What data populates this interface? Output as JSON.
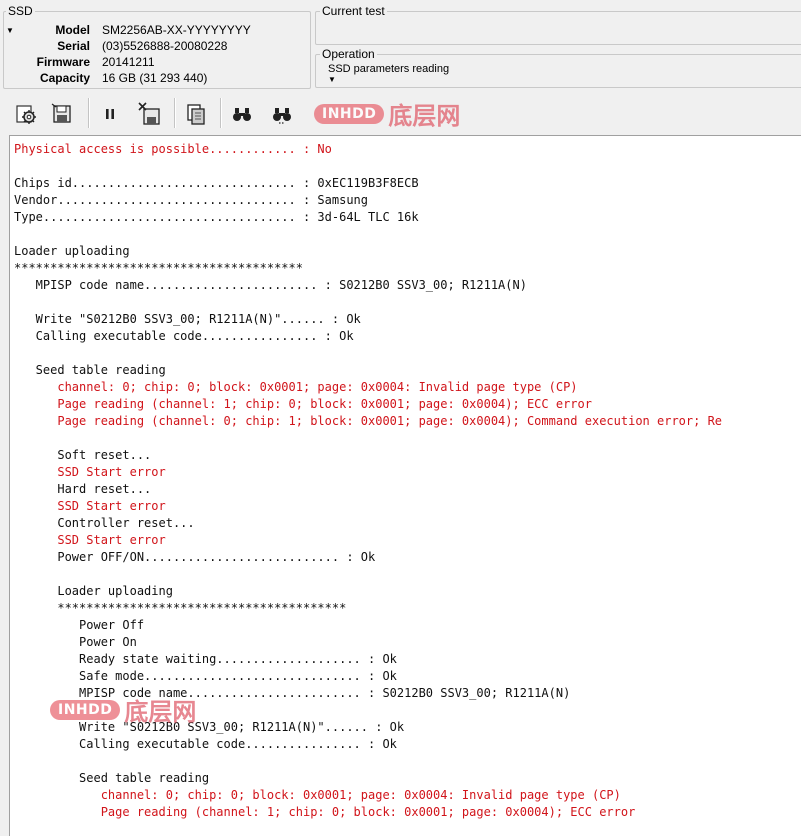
{
  "ssd_panel": {
    "title": "SSD",
    "fields": [
      {
        "label": "Model",
        "value": "SM2256AB-XX-YYYYYYYY"
      },
      {
        "label": "Serial",
        "value": "(03)5526888-20080228"
      },
      {
        "label": "Firmware",
        "value": "20141211"
      },
      {
        "label": "Capacity",
        "value": "16 GB (31 293 440)"
      }
    ]
  },
  "current_test": {
    "title": "Current test",
    "value": ""
  },
  "operation": {
    "title": "Operation",
    "value": "SSD parameters reading"
  },
  "toolbar": {
    "buttons": [
      {
        "icon": "gear-settings-icon"
      },
      {
        "icon": "save-drive-icon"
      },
      {
        "icon": "pause-icon"
      },
      {
        "icon": "cancel-save-icon"
      },
      {
        "icon": "copy-icon"
      },
      {
        "icon": "binoculars-icon"
      },
      {
        "icon": "binoculars-next-icon"
      }
    ]
  },
  "watermark": {
    "logo_text": "INHDD",
    "site_text": "底层网"
  },
  "log": [
    {
      "text": "Physical access is possible............ : No",
      "level": "error"
    },
    {
      "text": "",
      "level": "info"
    },
    {
      "text": "Chips id............................... : 0xEC119B3F8ECB",
      "level": "info"
    },
    {
      "text": "Vendor................................. : Samsung",
      "level": "info"
    },
    {
      "text": "Type................................... : 3d-64L TLC 16k",
      "level": "info"
    },
    {
      "text": "",
      "level": "info"
    },
    {
      "text": "Loader uploading",
      "level": "info"
    },
    {
      "text": "****************************************",
      "level": "info"
    },
    {
      "text": "   MPISP code name........................ : S0212B0 SSV3_00; R1211A(N)",
      "level": "info"
    },
    {
      "text": "",
      "level": "info"
    },
    {
      "text": "   Write \"S0212B0 SSV3_00; R1211A(N)\"...... : Ok",
      "level": "info"
    },
    {
      "text": "   Calling executable code................ : Ok",
      "level": "info"
    },
    {
      "text": "",
      "level": "info"
    },
    {
      "text": "   Seed table reading",
      "level": "info"
    },
    {
      "text": "      channel: 0; chip: 0; block: 0x0001; page: 0x0004: Invalid page type (CP)",
      "level": "error"
    },
    {
      "text": "      Page reading (channel: 1; chip: 0; block: 0x0001; page: 0x0004); ECC error",
      "level": "error"
    },
    {
      "text": "      Page reading (channel: 0; chip: 1; block: 0x0001; page: 0x0004); Command execution error; Re",
      "level": "error"
    },
    {
      "text": "",
      "level": "info"
    },
    {
      "text": "      Soft reset...",
      "level": "info"
    },
    {
      "text": "      SSD Start error",
      "level": "error"
    },
    {
      "text": "      Hard reset...",
      "level": "info"
    },
    {
      "text": "      SSD Start error",
      "level": "error"
    },
    {
      "text": "      Controller reset...",
      "level": "info"
    },
    {
      "text": "      SSD Start error",
      "level": "error"
    },
    {
      "text": "      Power OFF/ON........................... : Ok",
      "level": "info"
    },
    {
      "text": "",
      "level": "info"
    },
    {
      "text": "      Loader uploading",
      "level": "info"
    },
    {
      "text": "      ****************************************",
      "level": "info"
    },
    {
      "text": "         Power Off",
      "level": "info"
    },
    {
      "text": "         Power On",
      "level": "info"
    },
    {
      "text": "         Ready state waiting.................... : Ok",
      "level": "info"
    },
    {
      "text": "         Safe mode.............................. : Ok",
      "level": "info"
    },
    {
      "text": "         MPISP code name........................ : S0212B0 SSV3_00; R1211A(N)",
      "level": "info"
    },
    {
      "text": "",
      "level": "info"
    },
    {
      "text": "         Write \"S0212B0 SSV3_00; R1211A(N)\"...... : Ok",
      "level": "info"
    },
    {
      "text": "         Calling executable code................ : Ok",
      "level": "info"
    },
    {
      "text": "",
      "level": "info"
    },
    {
      "text": "         Seed table reading",
      "level": "info"
    },
    {
      "text": "            channel: 0; chip: 0; block: 0x0001; page: 0x0004: Invalid page type (CP)",
      "level": "error"
    },
    {
      "text": "            Page reading (channel: 1; chip: 0; block: 0x0001; page: 0x0004); ECC error",
      "level": "error"
    }
  ]
}
